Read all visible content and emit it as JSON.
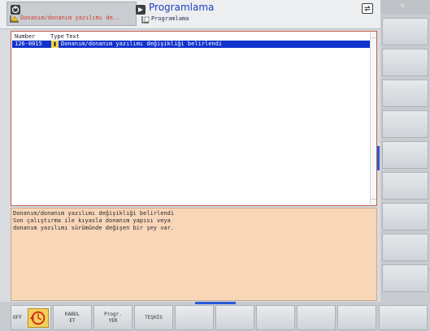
{
  "header": {
    "mode1_sub": "Donanım/donanım yazılımı de..",
    "mode2_title": "Programlama",
    "mode2_sub": "Programlama"
  },
  "list": {
    "columns": {
      "number": "Number",
      "type": "Type",
      "text": "Text"
    },
    "rows": [
      {
        "number": "126-0015",
        "text": "Donanım/donanım yazılımı değişikliği belirlendi"
      }
    ]
  },
  "detail": {
    "text": "Donanım/donanım yazılımı değişikliği belirlendi\nSon çalıştırma ile kıyasla donanım yapısı veya\ndonanım yazılımı sürümünde değişen bir şey var."
  },
  "right_top_label": "c",
  "softkeys": {
    "off_label": "OFF",
    "kabul": "KABUL\nET",
    "progr_yer": "Progr.\nYER",
    "teshis": "TEŞHİS"
  },
  "colors": {
    "selection": "#1133cc",
    "detail_bg": "#f8d6b8",
    "accent": "#2a5ad8",
    "mode1_text": "#d23b2b",
    "mode2_title": "#1e3fbf"
  },
  "icons": [
    "machine-mode-icon",
    "warning-icon",
    "program-mode-icon",
    "file-icon",
    "screen-switch-icon",
    "info-icon",
    "off-icon"
  ]
}
